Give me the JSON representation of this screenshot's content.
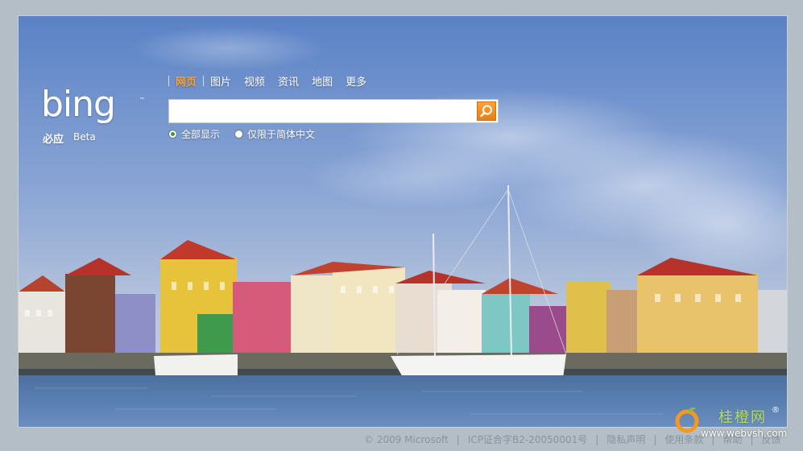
{
  "colors": {
    "page_bg": "#b4bec6",
    "nav_active": "#f3a23b",
    "search_button": "#f39a2c",
    "radio_checked": "#2f9e3a",
    "footer_text": "#8993a0",
    "watermark_green": "#b5db63"
  },
  "logo": {
    "wordmark": "bing",
    "trademark": "™",
    "cn_name": "必应",
    "beta": "Beta"
  },
  "nav": {
    "items": [
      {
        "label": "网页",
        "active": true
      },
      {
        "label": "图片",
        "active": false
      },
      {
        "label": "视频",
        "active": false
      },
      {
        "label": "资讯",
        "active": false
      },
      {
        "label": "地图",
        "active": false
      },
      {
        "label": "更多",
        "active": false
      }
    ]
  },
  "search": {
    "value": "",
    "placeholder": "",
    "button_icon": "magnifier-icon"
  },
  "scope": {
    "options": [
      {
        "label": "全部显示",
        "checked": true
      },
      {
        "label": "仅限于简体中文",
        "checked": false
      }
    ]
  },
  "footer": {
    "copyright": "© 2009 Microsoft",
    "icp": "ICP证合字B2-20050001号",
    "privacy": "隐私声明",
    "terms": "使用条款",
    "help": "帮助",
    "feedback": "反馈"
  },
  "watermark": {
    "cn": "桂橙网",
    "reg": "®",
    "url": "www.webvsh.com",
    "icon": "orange-logo-icon"
  }
}
